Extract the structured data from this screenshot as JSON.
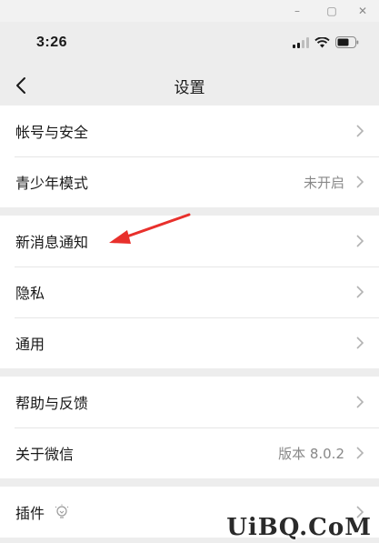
{
  "window": {
    "minimize_glyph": "–",
    "maximize_glyph": "▢",
    "close_glyph": "✕"
  },
  "status_bar": {
    "time": "3:26",
    "icons": [
      "signal-icon",
      "wifi-icon",
      "battery-icon"
    ]
  },
  "nav": {
    "back_icon": "chevron-left-icon",
    "title": "设置"
  },
  "groups": [
    {
      "items": [
        {
          "label": "帐号与安全",
          "value": ""
        },
        {
          "label": "青少年模式",
          "value": "未开启"
        }
      ]
    },
    {
      "items": [
        {
          "label": "新消息通知",
          "value": ""
        },
        {
          "label": "隐私",
          "value": ""
        },
        {
          "label": "通用",
          "value": ""
        }
      ]
    },
    {
      "items": [
        {
          "label": "帮助与反馈",
          "value": ""
        },
        {
          "label": "关于微信",
          "value": "版本 8.0.2"
        }
      ]
    },
    {
      "items": [
        {
          "label": "插件",
          "value": "",
          "icon": "lightbulb-icon"
        }
      ]
    }
  ],
  "annotation": {
    "color": "#e8302c"
  },
  "watermark": "UiBQ.CoM",
  "colors": {
    "background": "#ededed",
    "cell": "#ffffff",
    "secondary_text": "#888888",
    "chevron": "#b2b2b2"
  }
}
